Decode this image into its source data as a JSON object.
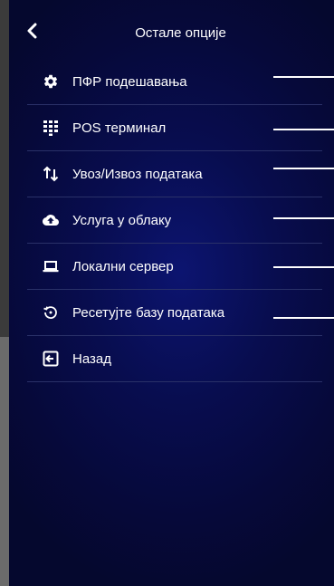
{
  "header": {
    "title": "Остале опције"
  },
  "menu": {
    "items": [
      {
        "label": "ПФР подешавања",
        "icon": "gear-icon"
      },
      {
        "label": "POS терминал",
        "icon": "keypad-icon"
      },
      {
        "label": "Увоз/Извоз података",
        "icon": "import-export-icon"
      },
      {
        "label": "Услуга у облаку",
        "icon": "cloud-upload-icon"
      },
      {
        "label": "Локални сервер",
        "icon": "laptop-icon"
      },
      {
        "label": "Ресетујте базу података",
        "icon": "reset-icon"
      },
      {
        "label": "Назад",
        "icon": "exit-icon"
      }
    ]
  },
  "colors": {
    "panel_background": "#080d4f",
    "text": "#ffffff",
    "divider": "#2a3168"
  }
}
